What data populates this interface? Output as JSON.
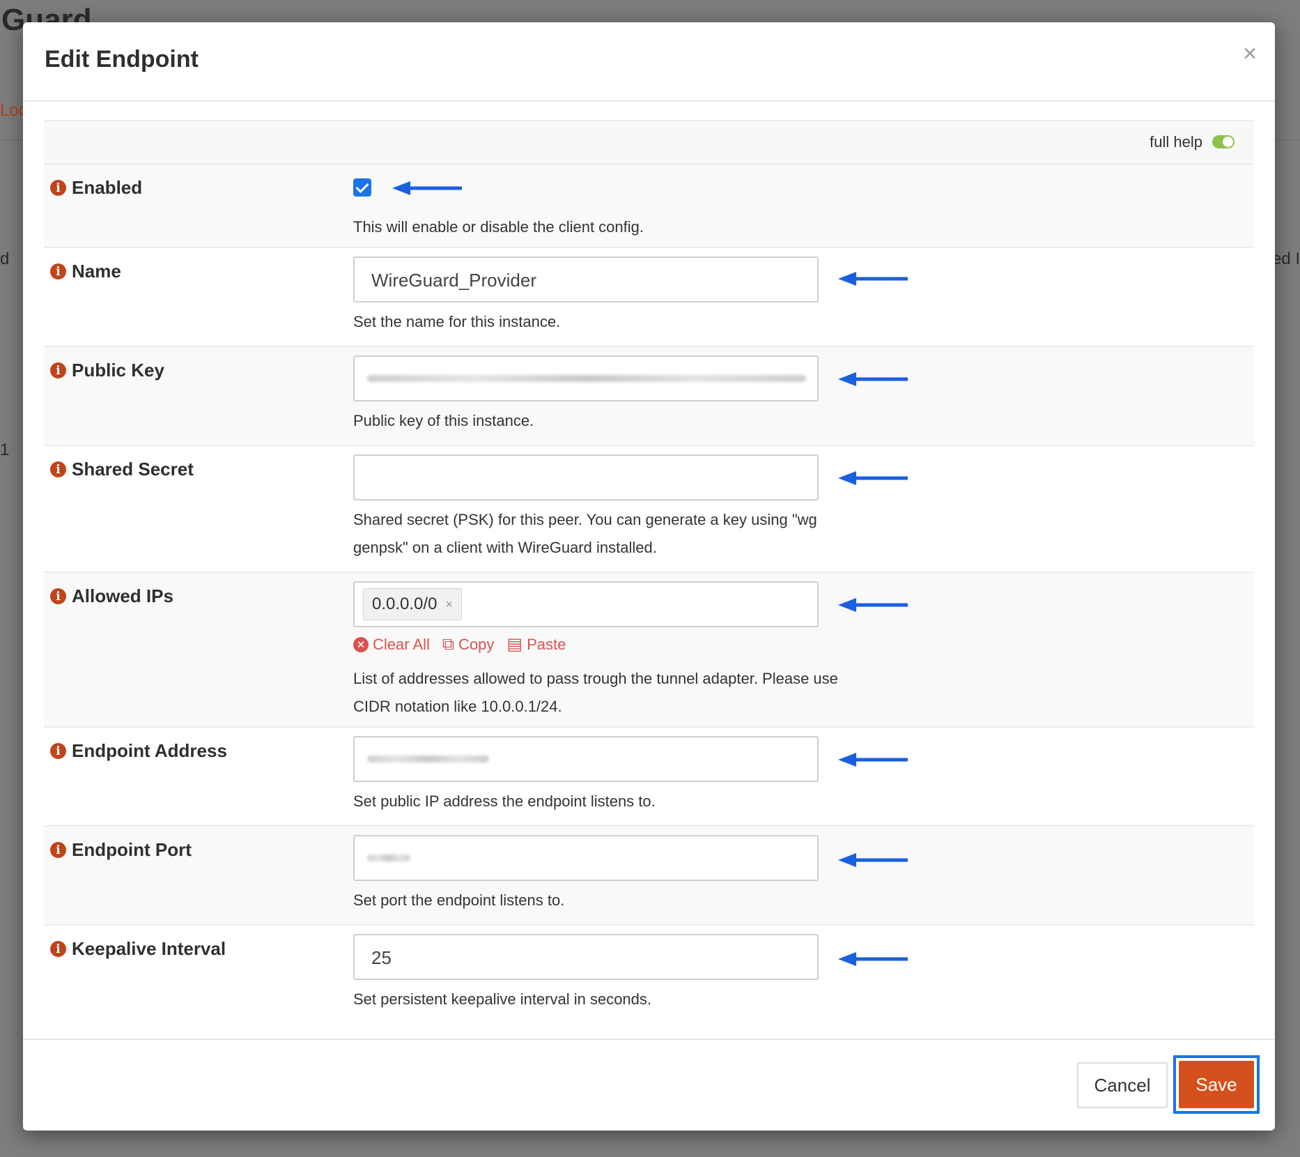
{
  "background": {
    "title": "Guard",
    "tab": "Loc",
    "frag_left_1": "d",
    "frag_left_2": "1",
    "frag_right": "ed I"
  },
  "modal": {
    "title": "Edit Endpoint",
    "close_glyph": "×",
    "full_help_label": "full help",
    "full_help_on": true
  },
  "fields": {
    "enabled": {
      "label": "Enabled",
      "checked": true,
      "help": "This will enable or disable the client config."
    },
    "name": {
      "label": "Name",
      "value": "WireGuard_Provider",
      "help": "Set the name for this instance."
    },
    "public_key": {
      "label": "Public Key",
      "help": "Public key of this instance."
    },
    "shared_secret": {
      "label": "Shared Secret",
      "value": "",
      "help": "Shared secret (PSK) for this peer. You can generate a key using \"wg genpsk\" on a client with WireGuard installed."
    },
    "allowed_ips": {
      "label": "Allowed IPs",
      "tags": [
        "0.0.0.0/0"
      ],
      "tag_remove_glyph": "×",
      "clear_all": "Clear All",
      "copy": "Copy",
      "paste": "Paste",
      "help": "List of addresses allowed to pass trough the tunnel adapter. Please use CIDR notation like 10.0.0.1/24."
    },
    "endpoint_address": {
      "label": "Endpoint Address",
      "help": "Set public IP address the endpoint listens to."
    },
    "endpoint_port": {
      "label": "Endpoint Port",
      "help": "Set port the endpoint listens to."
    },
    "keepalive": {
      "label": "Keepalive Interval",
      "value": "25",
      "help": "Set persistent keepalive interval in seconds."
    }
  },
  "footer": {
    "cancel": "Cancel",
    "save": "Save"
  },
  "colors": {
    "accent": "#d4501c",
    "info": "#c0441a",
    "arrow": "#1a5fe0",
    "focus": "#1a73e8",
    "toggle": "#8bc34a"
  }
}
